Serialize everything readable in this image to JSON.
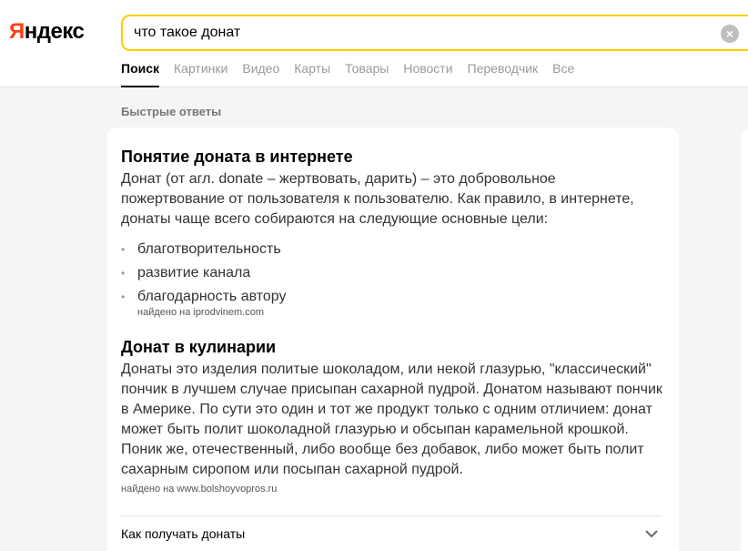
{
  "logo": {
    "first": "Я",
    "rest": "ндекс"
  },
  "search": {
    "value": "что такое донат"
  },
  "tabs": [
    {
      "label": "Поиск",
      "active": true
    },
    {
      "label": "Картинки"
    },
    {
      "label": "Видео"
    },
    {
      "label": "Карты"
    },
    {
      "label": "Товары"
    },
    {
      "label": "Новости"
    },
    {
      "label": "Переводчик"
    },
    {
      "label": "Все"
    }
  ],
  "section_label": "Быстрые ответы",
  "answer1": {
    "title": "Понятие доната в интернете",
    "text": "Донат (от агл. donate – жертвовать, дарить) – это добровольное пожертвование от пользователя к пользователю. Как правило, в интернете, донаты чаще всего собираются на следующие основные цели:",
    "bullets": [
      "благотворительность",
      "развитие канала",
      "благодарность автору"
    ],
    "source": "найдено на iprodvinem.com"
  },
  "answer2": {
    "title": "Донат в кулинарии",
    "text": "Донаты это изделия политые шоколадом, или некой глазурью, \"классический\" пончик в лучшем случае присыпан сахарной пудрой. Донатом называют пончик в Америке. По сути это один и тот же продукт только с одним отличием: донат может быть полит шоколадной глазурью и обсыпан карамельной крошкой. Поник же, отечественный, либо вообще без добавок, либо может быть полит сахарным сиропом или посыпан сахарной пудрой.",
    "source": "найдено на www.bolshoyvopros.ru"
  },
  "faq": {
    "question": "Как получать донаты"
  },
  "icons": {
    "clear": "clear-icon",
    "expand": "chevron-down-icon"
  },
  "colors": {
    "accent": "#ffcc00",
    "logo_red": "#fc3f1d"
  }
}
